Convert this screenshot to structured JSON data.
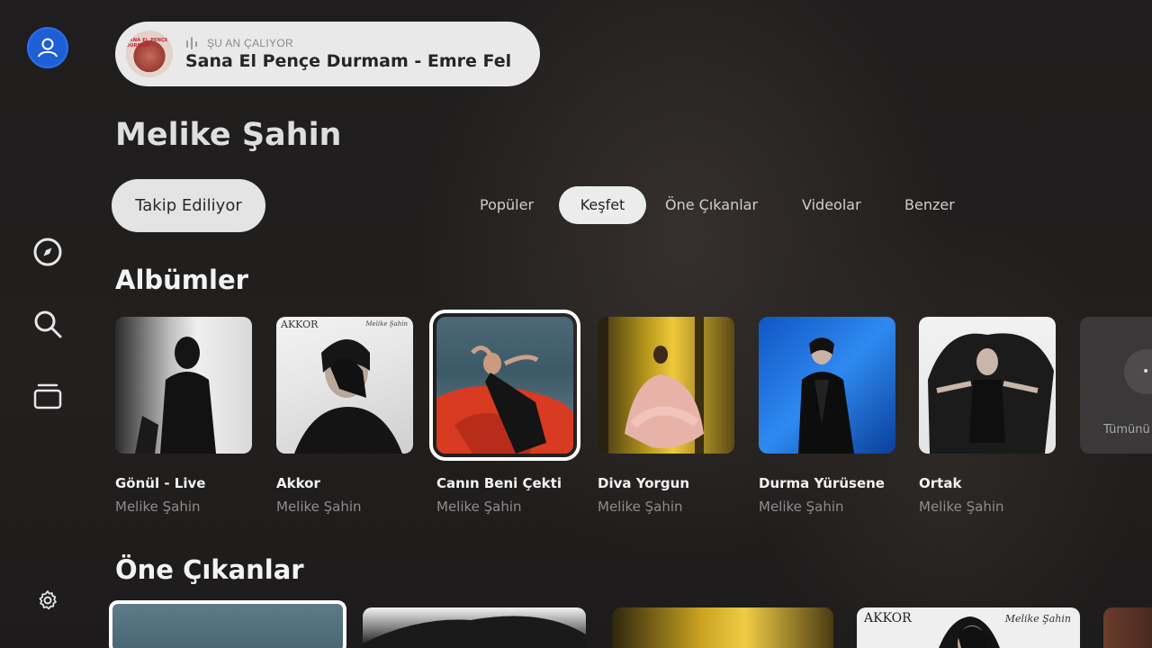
{
  "now_playing": {
    "status": "ŞU AN ÇALIYOR",
    "title": "Sana El Pençe Durmam - Emre Fel",
    "cover_text": "SANA EL PENÇE DURMAM"
  },
  "artist": {
    "name": "Melike Şahin",
    "follow_label": "Takip Ediliyor"
  },
  "tabs": [
    {
      "label": "Popüler",
      "selected": false
    },
    {
      "label": "Keşfet",
      "selected": true
    },
    {
      "label": "Öne Çıkanlar",
      "selected": false
    },
    {
      "label": "Videolar",
      "selected": false
    },
    {
      "label": "Benzer",
      "selected": false
    }
  ],
  "sections": {
    "albums_title": "Albümler",
    "featured_title": "Öne Çıkanlar"
  },
  "albums": [
    {
      "name": "Gönül - Live",
      "artist": "Melike Şahin"
    },
    {
      "name": "Akkor",
      "artist": "Melike Şahin",
      "cover_brand": "AKKOR",
      "cover_sign": "Melike Şahin"
    },
    {
      "name": "Canın Beni Çekti",
      "artist": "Melike Şahin",
      "focused": true
    },
    {
      "name": "Diva Yorgun",
      "artist": "Melike Şahin"
    },
    {
      "name": "Durma Yürüsene",
      "artist": "Melike Şahin"
    },
    {
      "name": "Ortak",
      "artist": "Melike Şahin"
    }
  ],
  "see_all": {
    "label": "Tümünü"
  },
  "featured": {
    "akkor_brand": "AKKOR",
    "akkor_sign": "Melike Şahin"
  },
  "colors": {
    "background": "#1e1c1c",
    "avatar": "#1f5fd6",
    "pill": "#e9e9e9",
    "accent_text": "#f2f2f2",
    "muted_text": "#8d8d8d"
  },
  "icons": [
    "user-icon",
    "compass-icon",
    "search-icon",
    "library-icon",
    "settings-icon",
    "equalizer-icon",
    "more-icon"
  ]
}
